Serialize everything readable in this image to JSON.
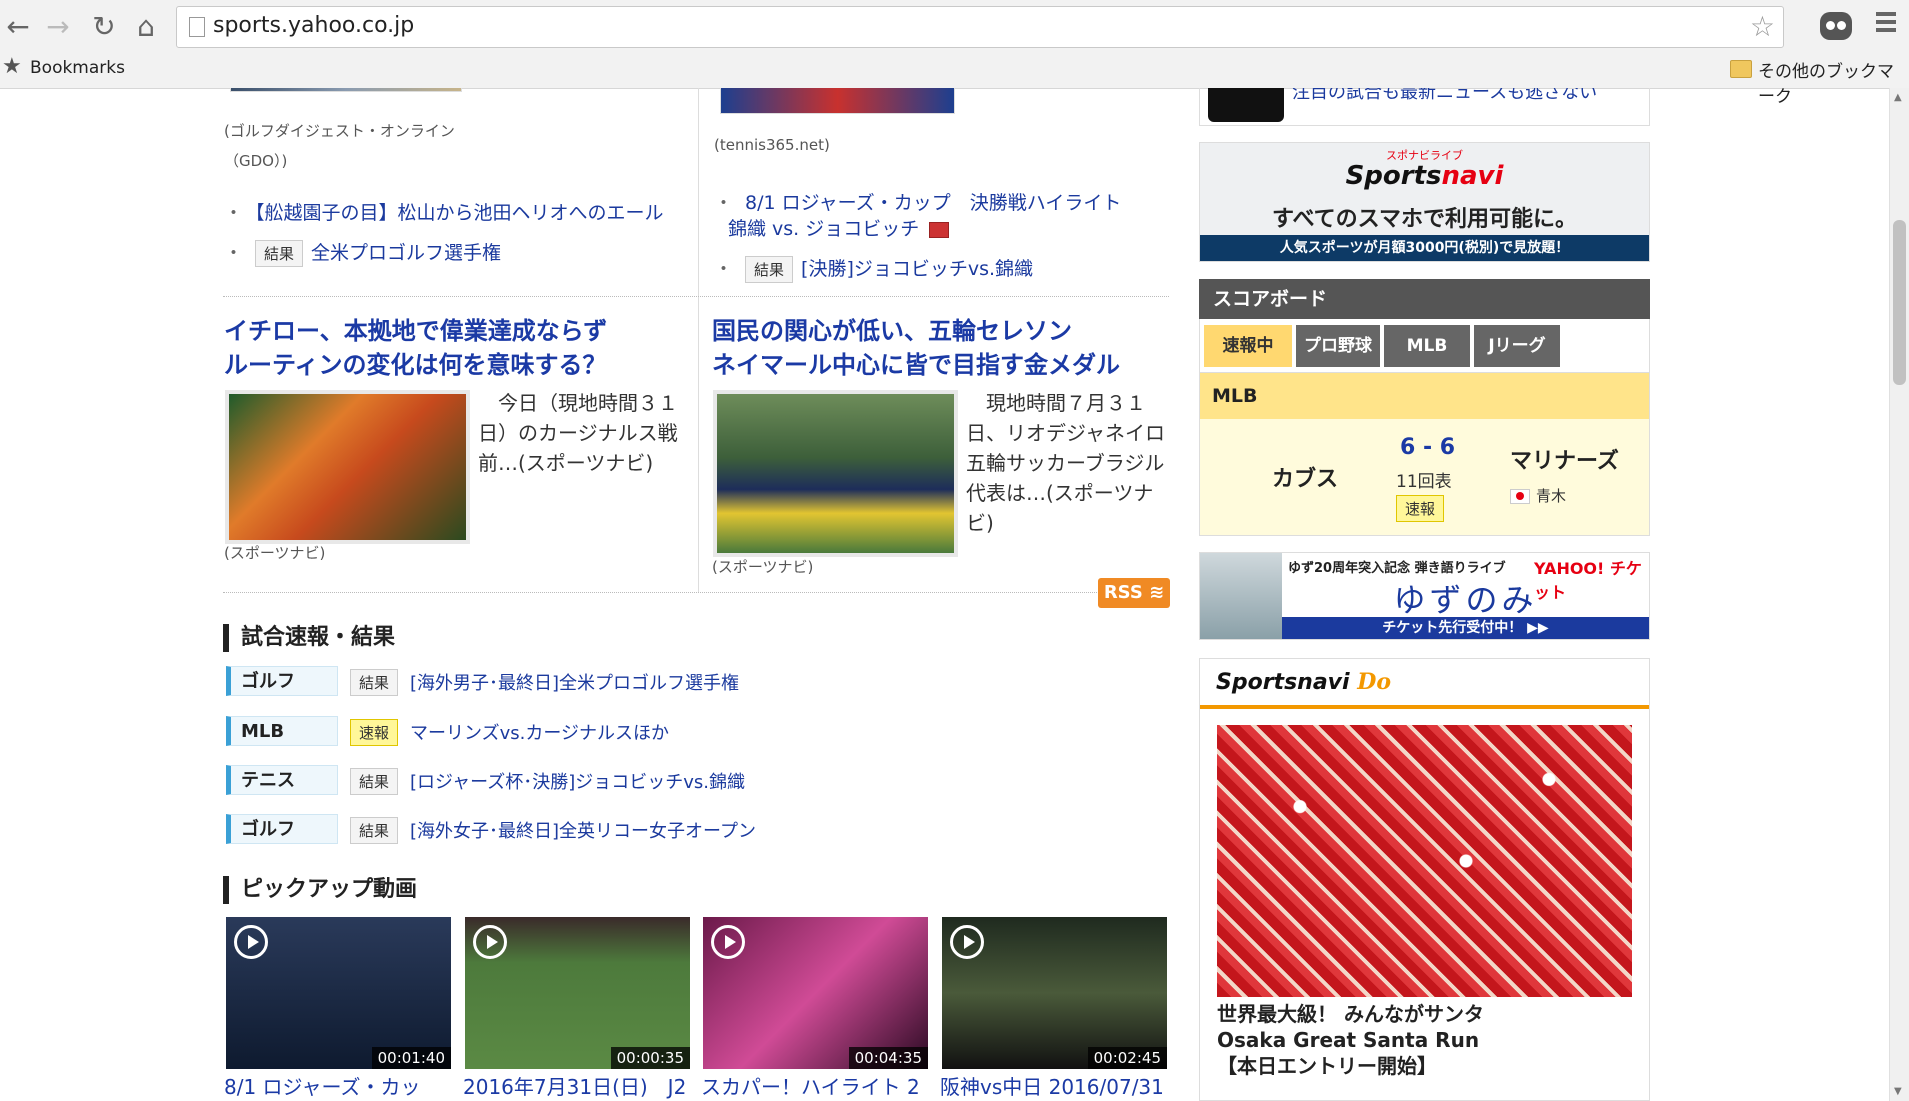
{
  "browser": {
    "url": "sports.yahoo.co.jp",
    "bookmarks_label": "Bookmarks",
    "other_bookmarks_label": "その他のブックマーク"
  },
  "top_snippets": {
    "left_source": "(ゴルフダイジェスト・オンライン（GDO）)",
    "right_source": "(tennis365.net)",
    "partial_text": "注目の試合も最新ニュースも逃さない"
  },
  "news_links_left": [
    {
      "badge": "",
      "text": "【舩越園子の目】松山から池田ヘリオへのエール"
    },
    {
      "badge": "結果",
      "text": "全米プロゴルフ選手権"
    }
  ],
  "news_links_right": [
    {
      "badge": "",
      "text": "8/1 ロジャーズ・カップ　決勝戦ハイライト",
      "text2": "錦織 vs. ジョコビッチ"
    },
    {
      "badge": "結果",
      "text": "[決勝]ジョコビッチvs.錦織"
    }
  ],
  "articles": [
    {
      "headline": [
        "イチロー、本拠地で偉業達成ならず",
        "ルーティンの変化は何を意味する？"
      ],
      "lead": [
        "　今日（現地時間３１",
        "日）のカージナルス戦",
        "前…(スポーツナビ)"
      ],
      "source": "(スポーツナビ)"
    },
    {
      "headline": [
        "国民の関心が低い、五輪セレソン",
        "ネイマール中心に皆で目指す金メダル"
      ],
      "lead": [
        "　現地時間７月３１",
        "日、リオデジャネイロ",
        "五輪サッカーブラジル",
        "代表は…(スポーツナ",
        "ビ)"
      ],
      "source": "(スポーツナビ)"
    }
  ],
  "results": {
    "title": "試合速報・結果",
    "rss_label": "RSS",
    "rows": [
      {
        "sport": "ゴルフ",
        "badge": "結果",
        "status": "result",
        "text": "[海外男子･最終日]全米プロゴルフ選手権"
      },
      {
        "sport": "MLB",
        "badge": "速報",
        "status": "live",
        "text": "マーリンズvs.カージナルスほか"
      },
      {
        "sport": "テニス",
        "badge": "結果",
        "status": "result",
        "text": "[ロジャーズ杯･決勝]ジョコビッチvs.錦織"
      },
      {
        "sport": "ゴルフ",
        "badge": "結果",
        "status": "result",
        "text": "[海外女子･最終日]全英リコー女子オープン"
      }
    ]
  },
  "videos": {
    "title": "ピックアップ動画",
    "items": [
      {
        "duration": "00:01:40",
        "title": "8/1 ロジャーズ・カッ"
      },
      {
        "duration": "00:00:35",
        "title": "2016年7月31日(日)　J2"
      },
      {
        "duration": "00:04:35",
        "title": "スカパー！ハイライト 2"
      },
      {
        "duration": "00:02:45",
        "title": "阪神vs中日 2016/07/31"
      }
    ]
  },
  "sportsnavi_banner": {
    "logo_prefix": "Sports",
    "logo_suffix": "navi",
    "small_label": "スポナビライブ",
    "main": "すべてのスマホで利用可能に。",
    "bottom": "人気スポーツが月額3000円(税別)で見放題！"
  },
  "scoreboard": {
    "title": "スコアボード",
    "tabs": [
      "速報中",
      "プロ野球",
      "MLB",
      "Jリーグ"
    ],
    "league": "MLB",
    "game": {
      "home": "カブス",
      "away": "マリナーズ",
      "score": "6 - 6",
      "inning": "11回表",
      "badge": "速報",
      "player": "青木"
    }
  },
  "yuzu_ad": {
    "top": "ゆず20周年突入記念 弾き語りライブ",
    "yahoo": "YAHOO! チケット",
    "main": "ゆずのみ",
    "bottom": "チケット先行受付中！ ▶▶"
  },
  "sportsnavi_do": {
    "logo_prefix": "Sportsnavi",
    "logo_suffix": "Do",
    "caption": [
      "世界最大級！ みんながサンタ",
      "Osaka Great Santa Run",
      "【本日エントリー開始】"
    ]
  }
}
